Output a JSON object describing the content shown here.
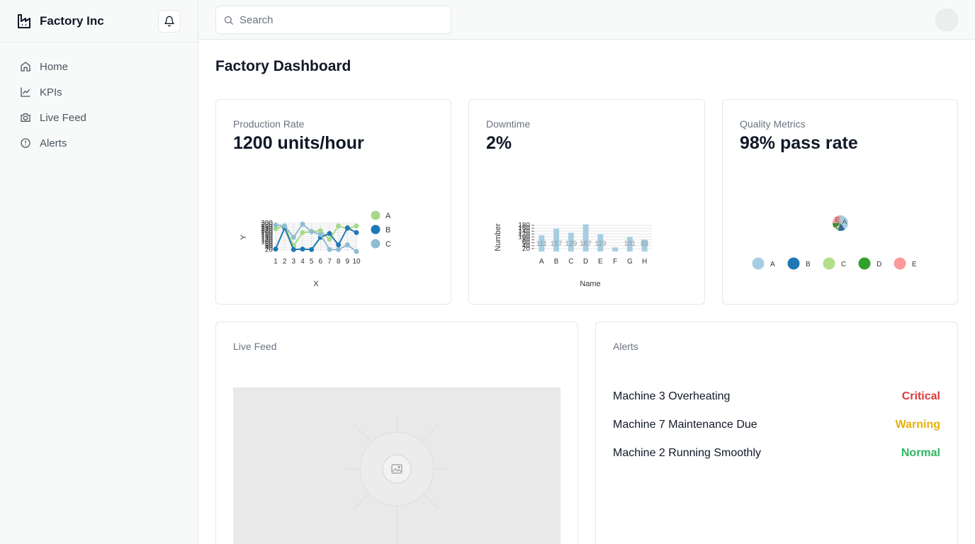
{
  "brand": {
    "name": "Factory Inc"
  },
  "nav": [
    {
      "label": "Home",
      "icon": "home-icon"
    },
    {
      "label": "KPIs",
      "icon": "chart-line-icon"
    },
    {
      "label": "Live Feed",
      "icon": "camera-icon"
    },
    {
      "label": "Alerts",
      "icon": "alert-circle-icon"
    }
  ],
  "search": {
    "placeholder": "Search",
    "value": ""
  },
  "page": {
    "title": "Factory Dashboard"
  },
  "cards": {
    "production": {
      "label": "Production Rate",
      "value": "1200 units/hour"
    },
    "downtime": {
      "label": "Downtime",
      "value": "2%"
    },
    "quality": {
      "label": "Quality Metrics",
      "value": "98% pass rate"
    },
    "live_feed": {
      "label": "Live Feed"
    },
    "alerts": {
      "label": "Alerts"
    }
  },
  "alerts": [
    {
      "name": "Machine 3 Overheating",
      "status": "Critical",
      "color": "#dc3a3a"
    },
    {
      "name": "Machine 7 Maintenance Due",
      "status": "Warning",
      "color": "#e5b00d"
    },
    {
      "name": "Machine 2 Running Smoothly",
      "status": "Normal",
      "color": "#2fb55f"
    }
  ],
  "chart_data": [
    {
      "type": "line",
      "xlabel": "X",
      "ylabel": "Y",
      "x": [
        1,
        2,
        3,
        4,
        5,
        6,
        7,
        8,
        9,
        10
      ],
      "ylim": [
        0,
        300
      ],
      "yticks": [
        20,
        40,
        60,
        80,
        100,
        120,
        140,
        160,
        180,
        200,
        220,
        240,
        260,
        280,
        300
      ],
      "legend": "right",
      "series": [
        {
          "name": "A",
          "color": "#a6d88a",
          "values": [
            240,
            270,
            60,
            200,
            210,
            220,
            130,
            270,
            240,
            270
          ]
        },
        {
          "name": "B",
          "color": "#1f78b4",
          "values": [
            25,
            250,
            20,
            25,
            20,
            150,
            190,
            70,
            250,
            200
          ]
        },
        {
          "name": "C",
          "color": "#8fbcd4",
          "values": [
            280,
            270,
            150,
            290,
            210,
            180,
            20,
            20,
            70,
            0
          ]
        }
      ]
    },
    {
      "type": "bar",
      "xlabel": "Name",
      "ylabel": "Number",
      "categories": [
        "A",
        "B",
        "C",
        "D",
        "E",
        "F",
        "G",
        "H"
      ],
      "values": [
        111,
        157,
        129,
        187,
        119,
        28,
        101,
        83
      ],
      "data_labels": [
        "111",
        "157",
        "129",
        "187",
        "119",
        "",
        "101",
        "83"
      ],
      "ylim": [
        0,
        200
      ],
      "yticks": [
        20,
        40,
        60,
        80,
        100,
        120,
        140,
        160,
        180
      ],
      "color": "#a6cee3"
    },
    {
      "type": "pie",
      "categories": [
        "A",
        "B",
        "C",
        "D",
        "E"
      ],
      "values": [
        40,
        15,
        10,
        10,
        25
      ],
      "colors": [
        "#a6cee3",
        "#1f78b4",
        "#b2df8a",
        "#33a02c",
        "#fb9a99"
      ],
      "legend": "bottom"
    }
  ]
}
